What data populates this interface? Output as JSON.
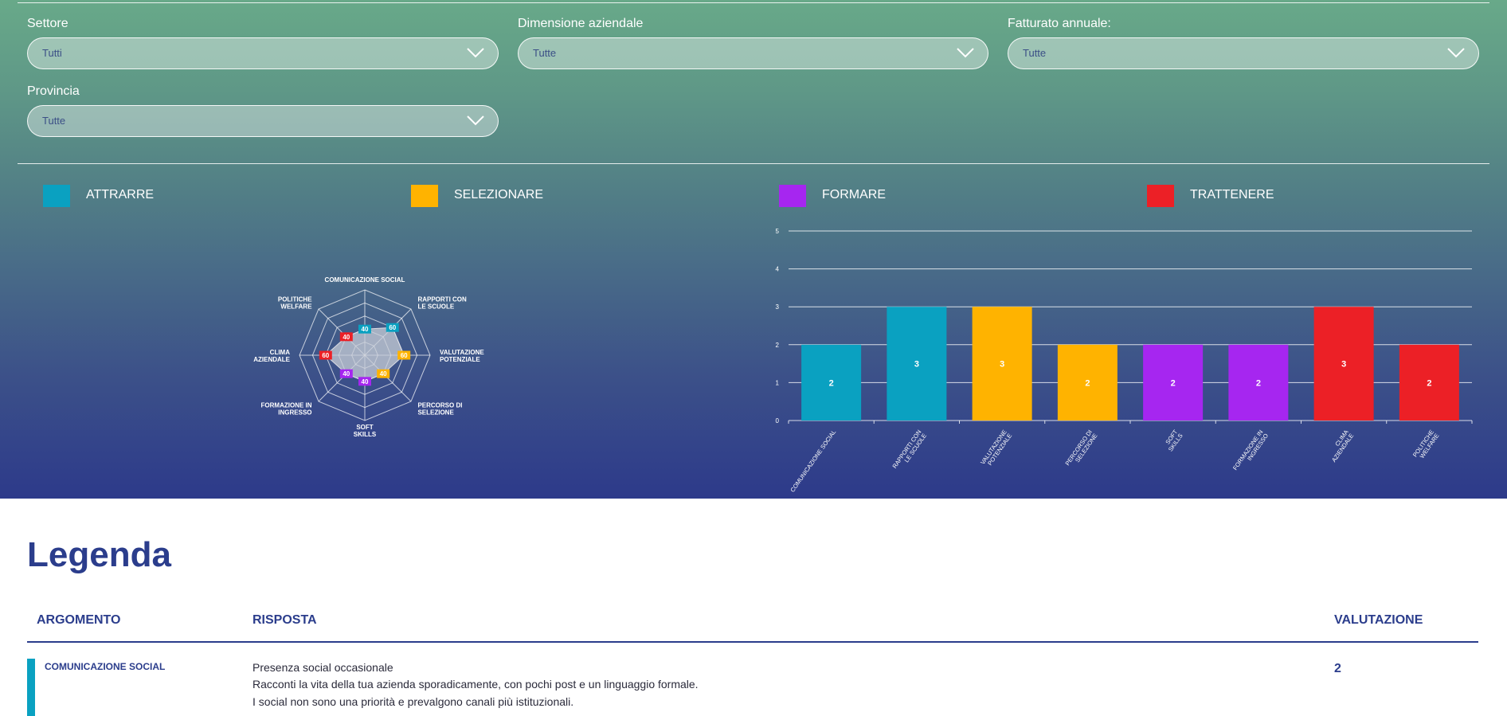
{
  "filters": [
    {
      "label": "Settore",
      "value": "Tutti"
    },
    {
      "label": "Dimensione aziendale",
      "value": "Tutte"
    },
    {
      "label": "Fatturato annuale:",
      "value": "Tutte"
    },
    {
      "label": "Provincia",
      "value": "Tutte"
    }
  ],
  "legend": [
    {
      "label": "ATTRARRE",
      "color": "#0aa1c1"
    },
    {
      "label": "SELEZIONARE",
      "color": "#ffb300"
    },
    {
      "label": "FORMARE",
      "color": "#a626f0"
    },
    {
      "label": "TRATTENERE",
      "color": "#ec2026"
    }
  ],
  "chart_data": [
    {
      "type": "radar",
      "axes": [
        "COMUNICAZIONE SOCIAL",
        "RAPPORTI CON LE SCUOLE",
        "VALUTAZIONE POTENZIALE",
        "PERCORSO DI SELEZIONE",
        "SOFT SKILLS",
        "FORMAZIONE IN INGRESSO",
        "CLIMA AZIENDALE",
        "POLITICHE WELFARE"
      ],
      "values": [
        40,
        60,
        60,
        40,
        40,
        40,
        60,
        40
      ],
      "colors": [
        "#0aa1c1",
        "#0aa1c1",
        "#ffb300",
        "#ffb300",
        "#a626f0",
        "#a626f0",
        "#ec2026",
        "#ec2026"
      ],
      "max": 100,
      "grid": true
    },
    {
      "type": "bar",
      "categories": [
        "COMUNICAZIONE SOCIAL",
        "RAPPORTI CON LE SCUOLE",
        "VALUTAZIONE POTENZIALE",
        "PERCORSO DI SELEZIONE",
        "SOFT SKILLS",
        "FORMAZIONE IN INGRESSO",
        "CLIMA AZIENDALE",
        "POLITICHE WELFARE"
      ],
      "values": [
        2,
        3,
        3,
        2,
        2,
        2,
        3,
        2
      ],
      "colors": [
        "#0aa1c1",
        "#0aa1c1",
        "#ffb300",
        "#ffb300",
        "#a626f0",
        "#a626f0",
        "#ec2026",
        "#ec2026"
      ],
      "ylim": [
        0,
        5
      ],
      "yticks": [
        0,
        1,
        2,
        3,
        4,
        5
      ],
      "grid": true
    }
  ],
  "legenda": {
    "title": "Legenda",
    "headers": {
      "topic": "ARGOMENTO",
      "answer": "RISPOSTA",
      "score": "VALUTAZIONE"
    },
    "rows": [
      {
        "topic": "COMUNICAZIONE SOCIAL",
        "color": "#0aa1c1",
        "answer": [
          "Presenza social occasionale",
          "Racconti la vita della tua azienda sporadicamente, con pochi post e un linguaggio formale.",
          "I social non sono una priorità e prevalgono canali più istituzionali."
        ],
        "score": "2"
      }
    ]
  }
}
